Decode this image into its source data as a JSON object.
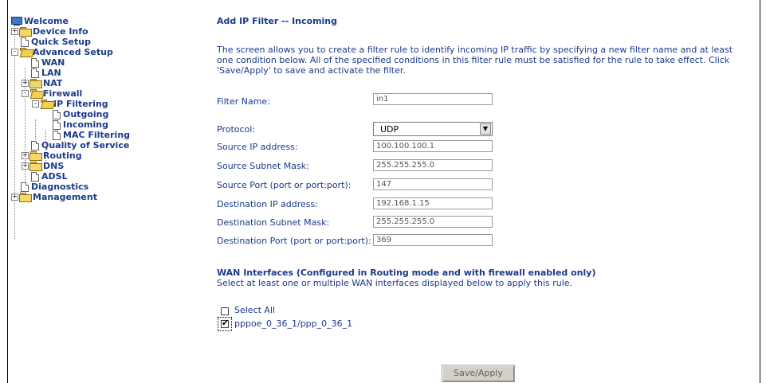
{
  "nav": {
    "items": [
      {
        "label": "Welcome",
        "icon": "monitor-icon"
      },
      {
        "label": "Device Info",
        "icon": "folder-icon",
        "expander": "+"
      },
      {
        "label": "Quick Setup",
        "icon": "document-icon"
      },
      {
        "label": "Advanced Setup",
        "icon": "folder-open-icon",
        "expander": "-"
      },
      {
        "label": "WAN",
        "icon": "document-icon"
      },
      {
        "label": "LAN",
        "icon": "document-icon"
      },
      {
        "label": "NAT",
        "icon": "folder-icon",
        "expander": "+"
      },
      {
        "label": "Firewall",
        "icon": "folder-open-icon",
        "expander": "-"
      },
      {
        "label": "IP Filtering",
        "icon": "folder-open-icon",
        "expander": "-"
      },
      {
        "label": "Outgoing",
        "icon": "document-icon"
      },
      {
        "label": "Incoming",
        "icon": "document-icon"
      },
      {
        "label": "MAC Filtering",
        "icon": "document-icon"
      },
      {
        "label": "Quality of Service",
        "icon": "document-icon"
      },
      {
        "label": "Routing",
        "icon": "folder-icon",
        "expander": "+"
      },
      {
        "label": "DNS",
        "icon": "folder-icon",
        "expander": "+"
      },
      {
        "label": "ADSL",
        "icon": "document-icon"
      },
      {
        "label": "Diagnostics",
        "icon": "document-icon"
      },
      {
        "label": "Management",
        "icon": "folder-icon",
        "expander": "+"
      }
    ]
  },
  "page": {
    "title": "Add IP Filter -- Incoming",
    "description": "The screen allows you to create a filter rule to identify incoming IP traffic by specifying a new filter name and at least one condition below. All of the specified conditions in this filter rule must be satisfied for the rule to take effect. Click 'Save/Apply' to save and activate the filter."
  },
  "form": {
    "filter_name": {
      "label": "Filter Name:",
      "value": "in1"
    },
    "protocol": {
      "label": "Protocol:",
      "value": "UDP"
    },
    "source_ip": {
      "label": "Source IP address:",
      "value": "100.100.100.1"
    },
    "source_mask": {
      "label": "Source Subnet Mask:",
      "value": "255.255.255.0"
    },
    "source_port": {
      "label": "Source Port (port or port:port):",
      "value": "147"
    },
    "dest_ip": {
      "label": "Destination IP address:",
      "value": "192.168.1.15"
    },
    "dest_mask": {
      "label": "Destination Subnet Mask:",
      "value": "255.255.255.0"
    },
    "dest_port": {
      "label": "Destination Port (port or port:port):",
      "value": "369"
    }
  },
  "wan": {
    "heading": "WAN Interfaces (Configured in Routing mode and with firewall enabled only)",
    "subheading": "Select at least one or multiple WAN interfaces displayed below to apply this rule.",
    "select_all": {
      "label": "Select All",
      "checked": false
    },
    "interface": {
      "label": "pppoe_0_36_1/ppp_0_36_1",
      "checked": true
    }
  },
  "actions": {
    "save_apply": "Save/Apply"
  }
}
